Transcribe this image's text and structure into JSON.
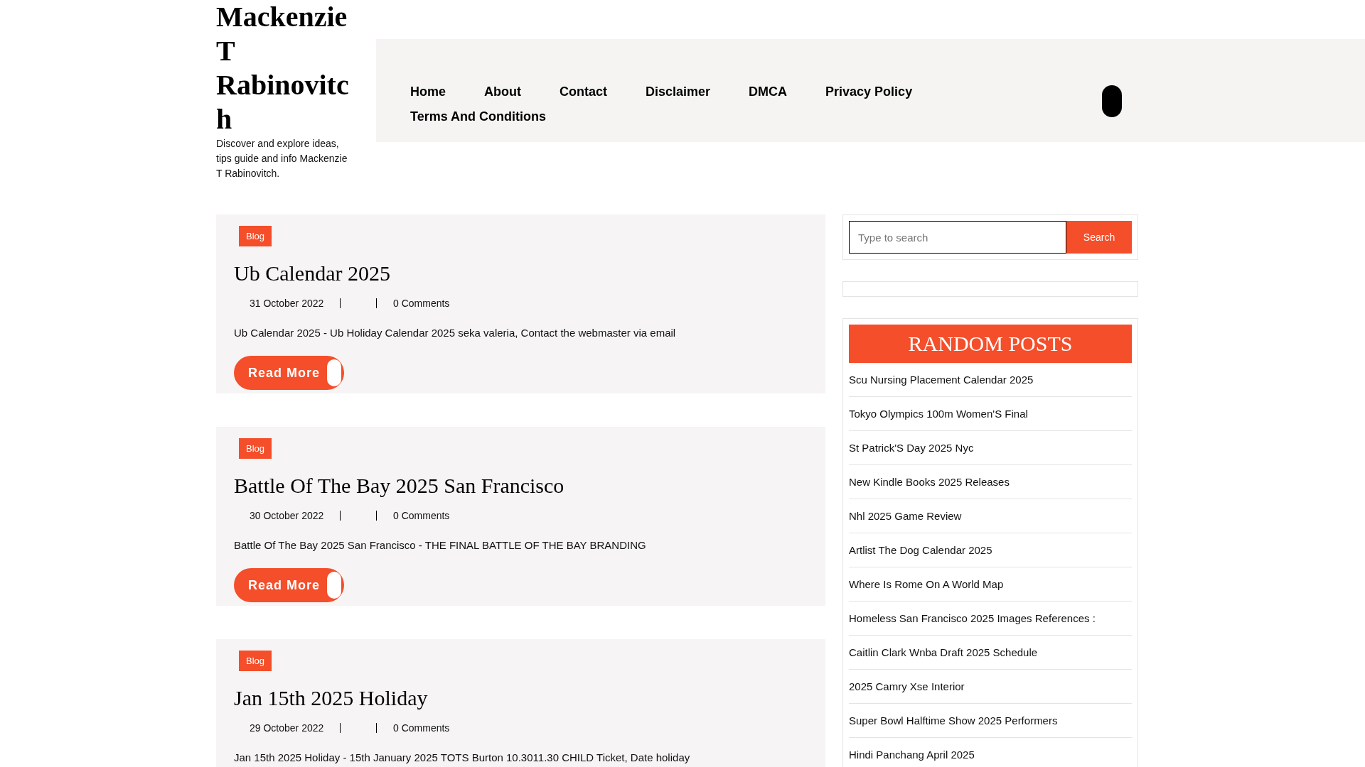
{
  "site": {
    "title": "Mackenzie T Rabinovitch",
    "tagline": "Discover and explore ideas, tips guide and info Mackenzie T Rabinovitch."
  },
  "nav": {
    "items": [
      "Home",
      "About",
      "Contact",
      "Disclaimer",
      "DMCA",
      "Privacy Policy",
      "Terms And Conditions"
    ]
  },
  "posts": [
    {
      "category": "Blog",
      "title": "Ub Calendar 2025",
      "date": "31 October 2022",
      "comments": "0 Comments",
      "excerpt": "Ub Calendar 2025 - Ub Holiday Calendar 2025 seka valeria, Contact the webmaster via email",
      "button": "Read More"
    },
    {
      "category": "Blog",
      "title": "Battle Of The Bay 2025 San Francisco",
      "date": "30 October 2022",
      "comments": "0 Comments",
      "excerpt": "Battle Of The Bay 2025 San Francisco - THE FINAL BATTLE OF THE BAY BRANDING",
      "button": "Read More"
    },
    {
      "category": "Blog",
      "title": "Jan 15th 2025 Holiday",
      "date": "29 October 2022",
      "comments": "0 Comments",
      "excerpt": "Jan 15th 2025 Holiday - 15th January 2025 TOTS Burton 10.3011.30 CHILD Ticket, Date holiday"
    }
  ],
  "search": {
    "placeholder": "Type to search",
    "button": "Search"
  },
  "random_posts": {
    "title": "RANDOM POSTS",
    "items": [
      "Scu Nursing Placement Calendar 2025",
      "Tokyo Olympics 100m Women'S Final",
      "St Patrick'S Day 2025 Nyc",
      "New Kindle Books 2025 Releases",
      "Nhl 2025 Game Review",
      "Artlist The Dog Calendar 2025",
      "Where Is Rome On A World Map",
      "Homeless San Francisco 2025 Images References :",
      "Caitlin Clark Wnba Draft 2025 Schedule",
      "2025 Camry Xse Interior",
      "Super Bowl Halftime Show 2025 Performers",
      "Hindi Panchang April 2025"
    ]
  }
}
